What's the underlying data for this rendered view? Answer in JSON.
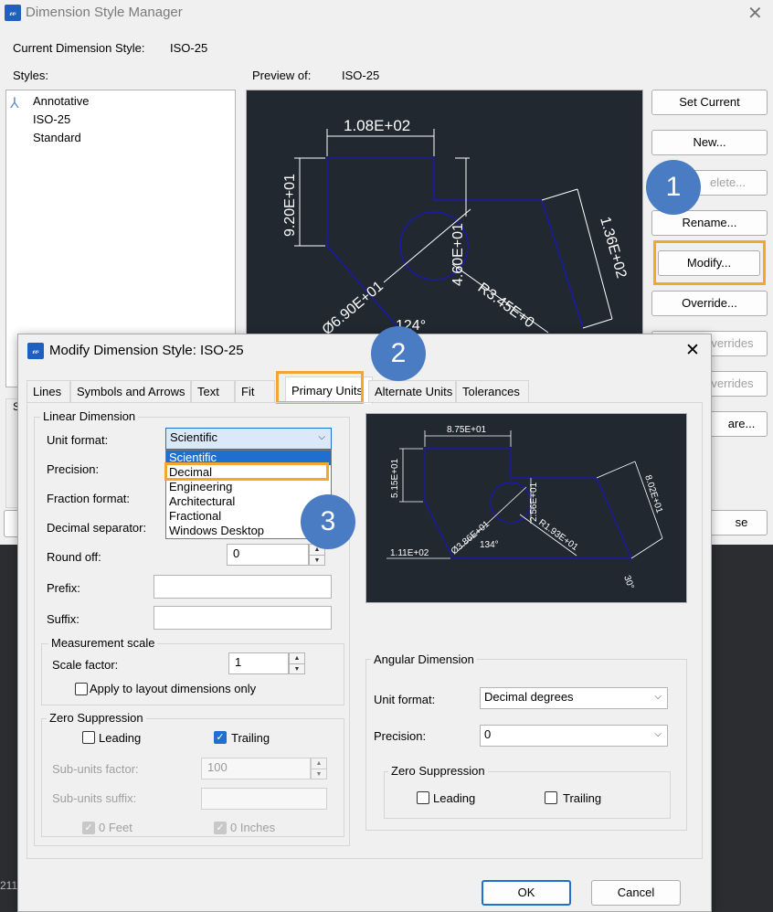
{
  "bg_window": {
    "title": "Dimension Style Manager",
    "current_style_label": "Current Dimension Style:",
    "current_style_value": "ISO-25",
    "styles_label": "Styles:",
    "preview_label": "Preview of:",
    "preview_value": "ISO-25",
    "styles": [
      "Annotative",
      "ISO-25",
      "Standard"
    ],
    "buttons": {
      "set_current": "Set Current",
      "new": "New...",
      "delete": "elete...",
      "rename": "Rename...",
      "modify": "Modify...",
      "override": "Override...",
      "compare_partial": "are...",
      "overrides1": "verrides",
      "overrides2": "verrides",
      "close_partial": "se"
    },
    "preview_dims": {
      "top": "1.08E+02",
      "left": "9.20E+01",
      "right": "1.36E+02",
      "inner": "4.60E+01",
      "radius": "R3.45E+0",
      "diameter": "Ø6.90E+01",
      "angle": "124°"
    }
  },
  "badges": [
    "1",
    "2",
    "3"
  ],
  "dialog": {
    "title": "Modify Dimension Style: ISO-25",
    "tabs": [
      "Lines",
      "Symbols and Arrows",
      "Text",
      "Fit",
      "Primary Units",
      "Alternate Units",
      "Tolerances"
    ],
    "active_tab": "Primary Units",
    "linear": {
      "group_title": "Linear Dimension",
      "unit_format_label": "Unit format:",
      "unit_format_value": "Scientific",
      "unit_format_options": [
        "Scientific",
        "Decimal",
        "Engineering",
        "Architectural",
        "Fractional",
        "Windows Desktop"
      ],
      "highlighted_option": "Decimal",
      "precision_label": "Precision:",
      "fraction_format_label": "Fraction format:",
      "decimal_sep_label": "Decimal separator:",
      "round_off_label": "Round off:",
      "round_off_value": "0",
      "prefix_label": "Prefix:",
      "suffix_label": "Suffix:",
      "measurement_title": "Measurement scale",
      "scale_factor_label": "Scale factor:",
      "scale_factor_value": "1",
      "apply_layout_label": "Apply to layout dimensions only",
      "zero_title": "Zero Suppression",
      "leading_label": "Leading",
      "trailing_label": "Trailing",
      "subunits_factor_label": "Sub-units factor:",
      "subunits_factor_value": "100",
      "subunits_suffix_label": "Sub-units suffix:",
      "feet_label": "0 Feet",
      "inches_label": "0 Inches"
    },
    "preview_dims": {
      "top": "8.75E+01",
      "left": "5.15E+01",
      "right": "8.02E+01",
      "inner": "2.56E+01",
      "radius": "R1.93E+01",
      "diameter": "Ø3.86E+01",
      "angle": "134°",
      "bottom": "1.11E+02",
      "angle2": "30°"
    },
    "angular": {
      "group_title": "Angular Dimension",
      "unit_format_label": "Unit format:",
      "unit_format_value": "Decimal degrees",
      "precision_label": "Precision:",
      "precision_value": "0",
      "zero_title": "Zero Suppression",
      "leading_label": "Leading",
      "trailing_label": "Trailing"
    },
    "ok": "OK",
    "cancel": "Cancel"
  },
  "taskbar_text": "211",
  "colors": {
    "accent": "#1f6fd1",
    "highlight": "#f0a830",
    "badge": "#4a7cc4",
    "preview_bg": "#212830",
    "geometry": "#1a1aa8"
  }
}
